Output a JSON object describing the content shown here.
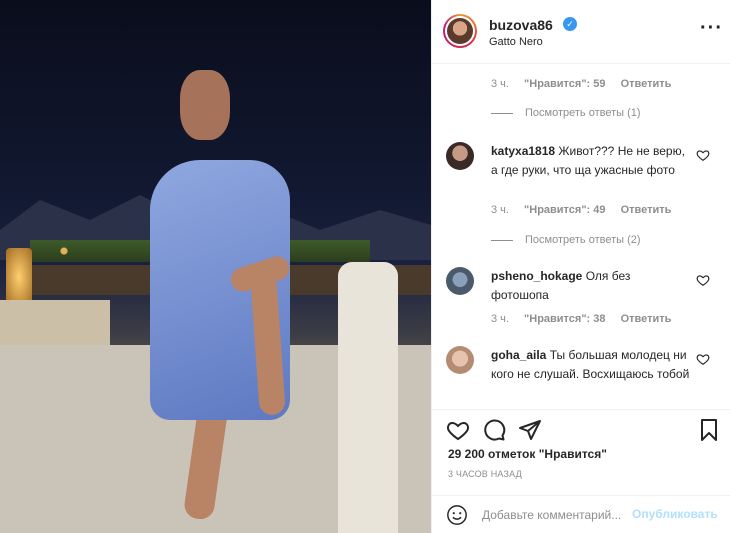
{
  "post": {
    "image_alt": "Photo of a woman in a blue satin dress at a restaurant terrace at night"
  },
  "header": {
    "username": "buzova86",
    "location": "Gatto Nero",
    "more_icon": "more-horizontal-icon"
  },
  "comments": {
    "top_meta": {
      "time": "3 ч.",
      "likes": "\"Нравится\": 59",
      "reply": "Ответить"
    },
    "top_view_replies": "Посмотреть ответы (1)",
    "items": [
      {
        "username": "katyxa1818",
        "text": "Живот??? Не не верю, а где руки, что ща ужасные фото",
        "time": "3 ч.",
        "likes": "\"Нравится\": 49",
        "reply": "Ответить",
        "view_replies": "Посмотреть ответы (2)"
      },
      {
        "username": "psheno_hokage",
        "text": "Оля без фотошопа",
        "time": "3 ч.",
        "likes": "\"Нравится\": 38",
        "reply": "Ответить"
      },
      {
        "username": "goha_aila",
        "text": "Ты большая молодец ни кого не слушай. Восхищаюсь тобой"
      }
    ]
  },
  "actions": {
    "likes": "29 200 отметок \"Нравится\"",
    "time_ago": "3 ЧАСОВ НАЗАД"
  },
  "add_comment": {
    "placeholder": "Добавьте комментарий...",
    "publish_label": "Опубликовать"
  },
  "colors": {
    "verified": "#3897f0",
    "muted": "#8e8e8e",
    "publish_disabled": "#b2dffc",
    "border": "#efefef"
  }
}
